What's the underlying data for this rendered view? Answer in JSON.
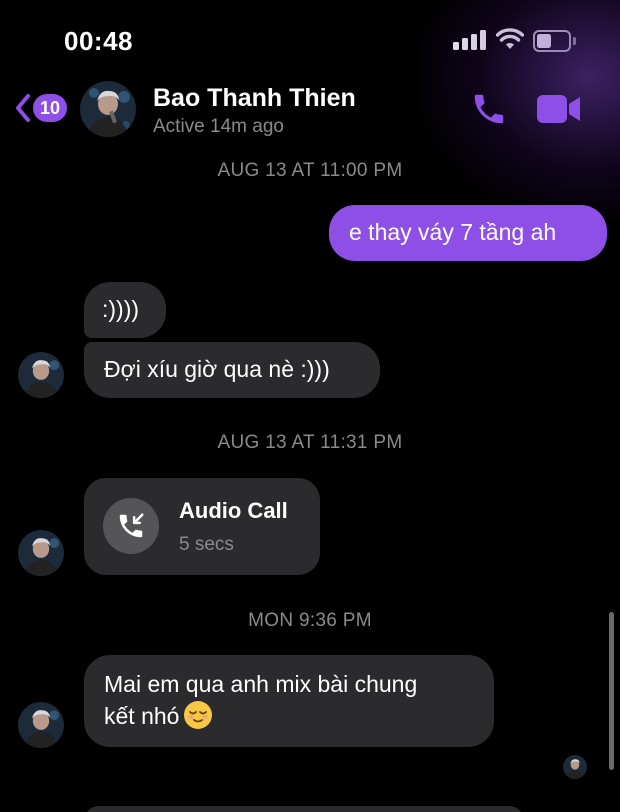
{
  "status_bar": {
    "time": "00:48"
  },
  "header": {
    "back_badge_count": "10",
    "contact_name": "Bao Thanh Thien",
    "contact_status": "Active 14m ago",
    "icons": [
      "back-chevron-icon",
      "phone-icon",
      "video-camera-icon"
    ]
  },
  "colors": {
    "accent": "#8e4fe6",
    "incoming_bubble": "#2b2b2d",
    "muted_text": "#8a8a8a",
    "background": "#000000"
  },
  "conversation": {
    "timestamp_1": "AUG 13 AT 11:00 PM",
    "msg_out_1": "e thay váy 7 tầng ah",
    "msg_in_1": ":))))",
    "msg_in_2": "Đợi xíu giờ qua nè :)))",
    "timestamp_2": "AUG 13 AT 11:31 PM",
    "audio_call": {
      "title": "Audio Call",
      "duration": "5 secs",
      "icon": "missed-call-icon"
    },
    "timestamp_3": "MON 9:36 PM",
    "msg_in_3_line1": "Mai em qua anh mix bài chung",
    "msg_in_3_line2": "kết nhó",
    "msg_in_3_emoji": "relieved-face-emoji"
  }
}
